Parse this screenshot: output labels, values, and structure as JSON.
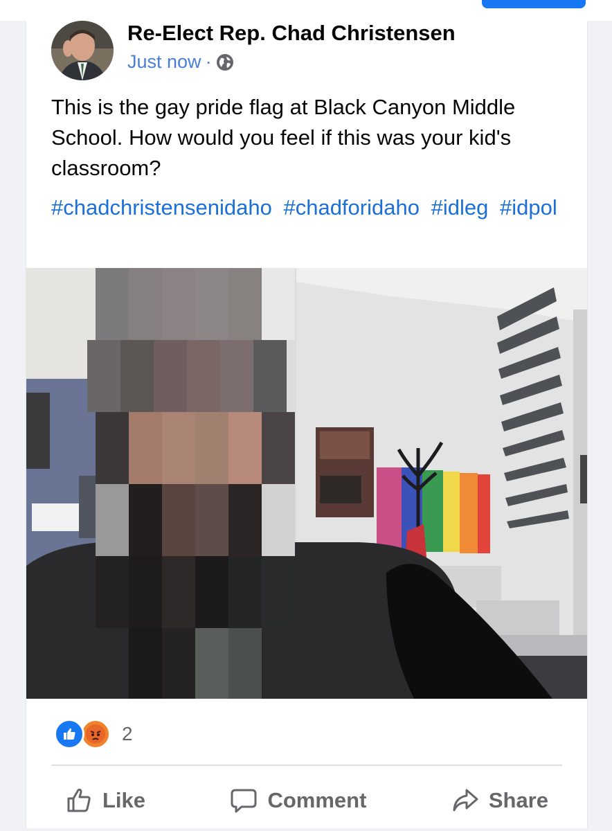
{
  "post": {
    "author": "Re-Elect Rep. Chad Christensen",
    "timestamp": "Just now",
    "separator": "·",
    "audience_icon": "globe-icon",
    "text": "This is the gay pride flag at Black Canyon Middle School. How would you feel if this was your kid's classroom?",
    "hashtags": [
      "#chadchristensenidaho",
      "#chadforidaho",
      "#idleg",
      "#idpol"
    ]
  },
  "reactions": {
    "icons": [
      "like-reaction-icon",
      "angry-reaction-icon"
    ],
    "count": "2"
  },
  "actions": {
    "like": "Like",
    "comment": "Comment",
    "share": "Share"
  },
  "colors": {
    "brand_blue": "#1877f2",
    "hashtag_blue": "#1b6fd6",
    "meta_blue": "#4a7fd6",
    "muted_gray": "#65676b",
    "angry_orange": "#f0832c"
  }
}
